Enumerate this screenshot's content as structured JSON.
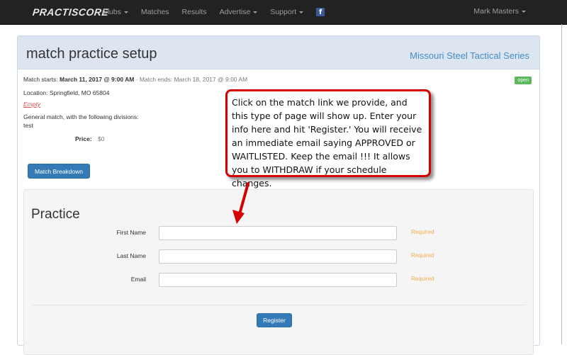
{
  "nav": {
    "brand": "PRACTISCORE",
    "items": [
      {
        "label": "Clubs",
        "dropdown": true
      },
      {
        "label": "Matches",
        "dropdown": false
      },
      {
        "label": "Results",
        "dropdown": false
      },
      {
        "label": "Advertise",
        "dropdown": true
      },
      {
        "label": "Support",
        "dropdown": true
      }
    ],
    "facebook_icon": "f",
    "user": "Mark Masters"
  },
  "match": {
    "title": "match practice setup",
    "series": "Missouri Steel Tactical Series",
    "starts_label": "Match starts:",
    "starts_value": "March 11, 2017 @ 9:00 AM",
    "ends_text": "· Match ends: March 18, 2017 @ 9:00 AM",
    "location": "Location: Springfield, MO 65804",
    "empty_link": "Empty",
    "divisions_text": "General match, with the following divisions:",
    "division": "test",
    "price_label": "Price:",
    "price_value": "$0",
    "status_badge": "open",
    "breakdown_button": "Match Breakdown"
  },
  "form": {
    "section_title": "Practice",
    "fields": [
      {
        "label": "First Name",
        "value": "",
        "required": "Required"
      },
      {
        "label": "Last Name",
        "value": "",
        "required": "Required"
      },
      {
        "label": "Email",
        "value": "",
        "required": "Required"
      }
    ],
    "register_button": "Register"
  },
  "annotation": {
    "text": "Click on the match link we provide, and this type of page will show up.  Enter your info here and hit 'Register.'  You will receive an immediate email saying APPROVED or WAITLISTED.  Keep the email !!!  It allows you to WITHDRAW if your schedule changes."
  },
  "colors": {
    "navbar": "#222222",
    "panel_heading": "#dde6f0",
    "link": "#428bca",
    "primary_button": "#337ab7",
    "required": "#f0ad4e",
    "badge_open": "#5cb85c",
    "callout_border": "#d40000"
  }
}
